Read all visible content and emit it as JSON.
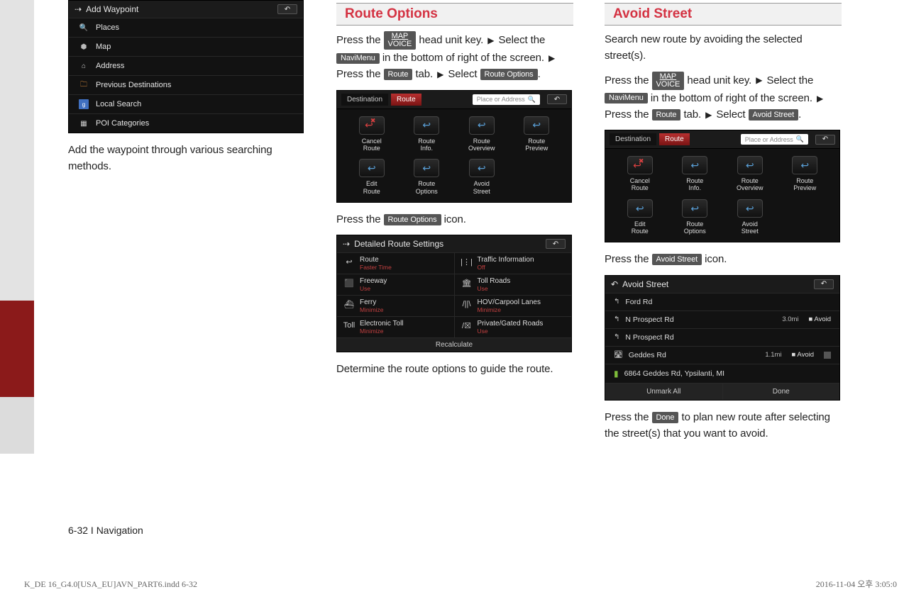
{
  "sidebar": {},
  "col1": {
    "shot_title": "Add Waypoint",
    "rows": [
      "Places",
      "Map",
      "Address",
      "Previous Destinations",
      "Local Search",
      "POI Categories"
    ],
    "caption": "Add the waypoint through various searching methods."
  },
  "col2": {
    "heading": "Route Options",
    "p1_a": "Press the ",
    "p1_key_map_top": "MAP",
    "p1_key_map_bot": "VOICE",
    "p1_b": " head unit key. ",
    "p1_c": " Select the ",
    "p1_key_navi_top": "Navi",
    "p1_key_navi_bot": "Menu",
    "p1_d": " in the bottom of right of the screen. ",
    "p1_e": " Press the ",
    "p1_key_route": "Route",
    "p1_f": " tab. ",
    "p1_g": " Select ",
    "p1_key_routeopts": "Route Options",
    "p1_h": ".",
    "tabs": {
      "dest": "Destination",
      "route": "Route",
      "search": "Place or Address"
    },
    "grid": [
      {
        "label": "Cancel\nRoute",
        "red": true
      },
      {
        "label": "Route\nInfo."
      },
      {
        "label": "Route\nOverview"
      },
      {
        "label": "Route\nPreview"
      },
      {
        "label": "Edit\nRoute"
      },
      {
        "label": "Route\nOptions"
      },
      {
        "label": "Avoid\nStreet"
      }
    ],
    "p2_a": "Press the ",
    "p2_key": "Route Options",
    "p2_b": " icon.",
    "det_title": "Detailed Route Settings",
    "det": [
      [
        "↩",
        "Route",
        "Faster Time",
        "|⋮|",
        "Traffic Information",
        "Off"
      ],
      [
        "⬛",
        "Freeway",
        "Use",
        "🏛",
        "Toll Roads",
        "Use"
      ],
      [
        "⛴",
        "Ferry",
        "Minimize",
        "/||\\",
        "HOV/Carpool Lanes",
        "Minimize"
      ],
      [
        "Toll",
        "Electronic Toll",
        "Minimize",
        "/☒",
        "Private/Gated Roads",
        "Use"
      ]
    ],
    "recalc": "Recalculate",
    "p3": "Determine the route options to guide the route."
  },
  "col3": {
    "heading": "Avoid Street",
    "intro": "Search new route by avoiding the selected street(s).",
    "p1_a": "Press the ",
    "p1_key_map_top": "MAP",
    "p1_key_map_bot": "VOICE",
    "p1_b": " head unit key. ",
    "p1_c": " Select the ",
    "p1_key_navi_top": "Navi",
    "p1_key_navi_bot": "Menu",
    "p1_d": " in the bottom of right of the screen. ",
    "p1_e": " Press the ",
    "p1_key_route": "Route",
    "p1_f": " tab. ",
    "p1_g": " Select ",
    "p1_key_avoid": "Avoid Street",
    "p1_h": ".",
    "tabs": {
      "dest": "Destination",
      "route": "Route",
      "search": "Place or Address"
    },
    "grid": [
      {
        "label": "Cancel\nRoute",
        "red": true
      },
      {
        "label": "Route\nInfo."
      },
      {
        "label": "Route\nOverview"
      },
      {
        "label": "Route\nPreview"
      },
      {
        "label": "Edit\nRoute"
      },
      {
        "label": "Route\nOptions"
      },
      {
        "label": "Avoid\nStreet"
      }
    ],
    "p2_a": "Press the ",
    "p2_key": "Avoid Street",
    "p2_b": " icon.",
    "av_title": "Avoid Street",
    "av_rows": [
      {
        "icon": "↰",
        "name": "Ford Rd",
        "dist": "",
        "chk": false
      },
      {
        "icon": "↰",
        "name": "N Prospect Rd",
        "dist": "3.0mi",
        "avoid": "Avoid",
        "chk": true
      },
      {
        "icon": "↰",
        "name": "N Prospect Rd",
        "dist": "",
        "chk": false
      },
      {
        "icon": "🛣",
        "name": "Geddes Rd",
        "dist": "1.1mi",
        "avoid": "Avoid",
        "chk": false,
        "chkbox": true
      },
      {
        "icon": "▮",
        "name": "6864 Geddes Rd, Ypsilanti, MI",
        "dist": "",
        "chk": false,
        "green": true
      }
    ],
    "av_foot": {
      "left": "Unmark All",
      "right": "Done"
    },
    "p3_a": "Press the ",
    "p3_key": "Done",
    "p3_b": " to plan new route after selecting the street(s) that you want to avoid."
  },
  "pagefooter": "6-32 I Navigation",
  "printL": "K_DE 16_G4.0[USA_EU]AVN_PART6.indd   6-32",
  "printR": "2016-11-04   오후 3:05:0"
}
